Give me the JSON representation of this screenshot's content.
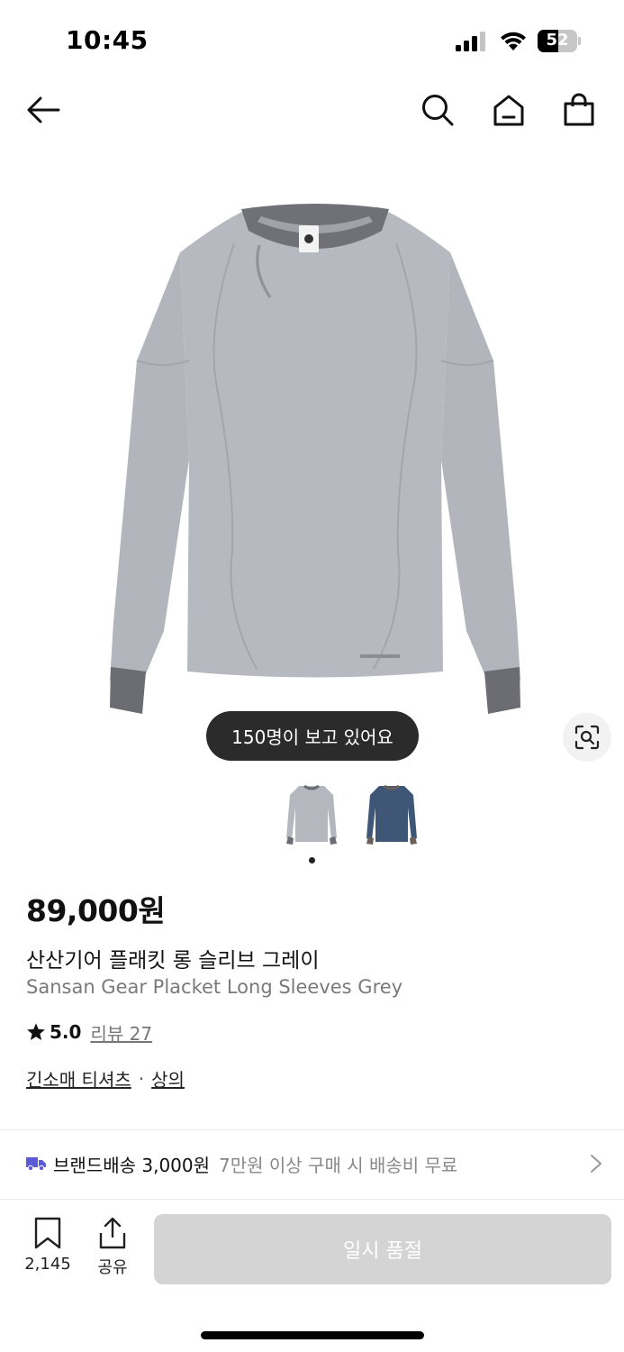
{
  "status_bar": {
    "time": "10:45",
    "battery": "52",
    "battery_level": 0.52
  },
  "nav": {
    "back_icon": "arrow-left-icon",
    "search_icon": "search-icon",
    "home_icon": "home-icon",
    "cart_icon": "shopping-bag-icon"
  },
  "product": {
    "viewers": "150명이 보고 있어요",
    "price": "89,000원",
    "name_ko": "산산기어 플래킷 롱 슬리브 그레이",
    "name_en": "Sansan Gear Placket Long Sleeves Grey",
    "rating": "5.0",
    "review_label": "리뷰 27",
    "categories": [
      "긴소매 티셔츠",
      "상의"
    ],
    "category_separator": "·",
    "colors": [
      "#b4b7bd",
      "#3f5677"
    ],
    "selected_image_index": 0
  },
  "shipping": {
    "main": "브랜드배송 3,000원",
    "sub": "7만원 이상 구매 시 배송비 무료",
    "icon_color": "#5b5bd6"
  },
  "bottom_bar": {
    "save_count": "2,145",
    "share_label": "공유",
    "buy_label": "일시 품절"
  }
}
